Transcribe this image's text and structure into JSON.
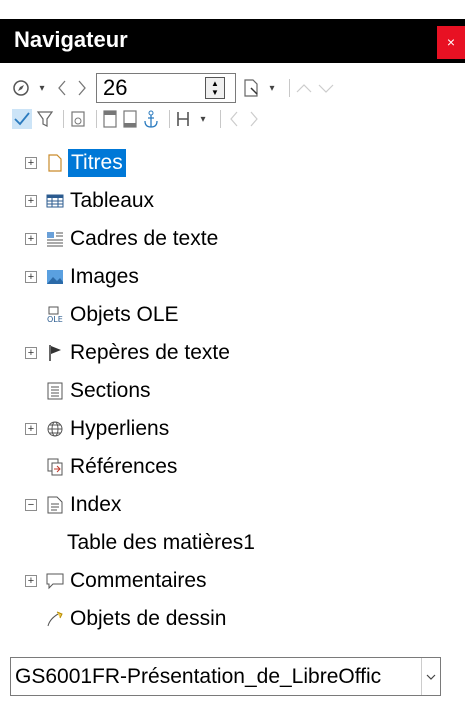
{
  "window": {
    "title": "Navigateur",
    "close_glyph": "×"
  },
  "toolbar1": {
    "page_number": "26"
  },
  "tree": [
    {
      "label": "Titres",
      "icon": "titles-icon",
      "expander": "+",
      "selected": true
    },
    {
      "label": "Tableaux",
      "icon": "table-icon",
      "expander": "+"
    },
    {
      "label": "Cadres de texte",
      "icon": "text-frame-icon",
      "expander": "+"
    },
    {
      "label": "Images",
      "icon": "image-icon",
      "expander": "+"
    },
    {
      "label": "Objets OLE",
      "icon": "ole-icon",
      "expander": ""
    },
    {
      "label": "Repères de texte",
      "icon": "bookmark-flag-icon",
      "expander": "+"
    },
    {
      "label": "Sections",
      "icon": "section-icon",
      "expander": ""
    },
    {
      "label": "Hyperliens",
      "icon": "hyperlink-globe-icon",
      "expander": "+"
    },
    {
      "label": "Références",
      "icon": "reference-icon",
      "expander": ""
    },
    {
      "label": "Index",
      "icon": "index-icon",
      "expander": "−"
    },
    {
      "label": "Table des matières1",
      "icon": "",
      "expander": "",
      "child": true
    },
    {
      "label": "Commentaires",
      "icon": "comment-icon",
      "expander": "+"
    },
    {
      "label": "Objets de dessin",
      "icon": "drawing-icon",
      "expander": ""
    }
  ],
  "document_select": {
    "value": "GS6001FR-Présentation_de_LibreOffic"
  },
  "colors": {
    "selection": "#0078d7",
    "close": "#e81123",
    "titlebar": "#000000"
  }
}
